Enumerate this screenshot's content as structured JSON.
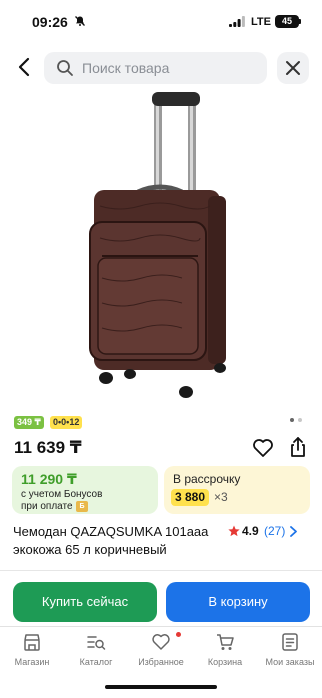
{
  "status_bar": {
    "time": "09:26",
    "network": "LTE",
    "battery": "45"
  },
  "search": {
    "placeholder": "Поиск товара"
  },
  "badges": {
    "price_badge": "349 ₸",
    "installment_badge": "0•0•12"
  },
  "product": {
    "price": "11 639 ₸",
    "title_line1": "Чемодан QAZAQSUMKA 101aaa",
    "title_line2": "экокожа 65 л коричневый",
    "rating": "4.9",
    "reviews": "(27)"
  },
  "bonus_card": {
    "price": "11 290 ₸",
    "line1": "с учетом Бонусов",
    "line2": "при оплате",
    "b_badge": "Б"
  },
  "installment_card": {
    "title": "В рассрочку",
    "amount": "3 880",
    "multiplier": "×3"
  },
  "actions": {
    "buy_now": "Купить сейчас",
    "add_to_cart": "В корзину"
  },
  "tabs": [
    {
      "label": "Магазин",
      "icon": "store-icon"
    },
    {
      "label": "Каталог",
      "icon": "catalog-icon"
    },
    {
      "label": "Избранное",
      "icon": "heart-icon"
    },
    {
      "label": "Корзина",
      "icon": "cart-icon"
    },
    {
      "label": "Мои заказы",
      "icon": "orders-icon"
    }
  ],
  "colors": {
    "green": "#1e9b55",
    "blue": "#1c73e8",
    "yellow": "#ffe14d"
  }
}
